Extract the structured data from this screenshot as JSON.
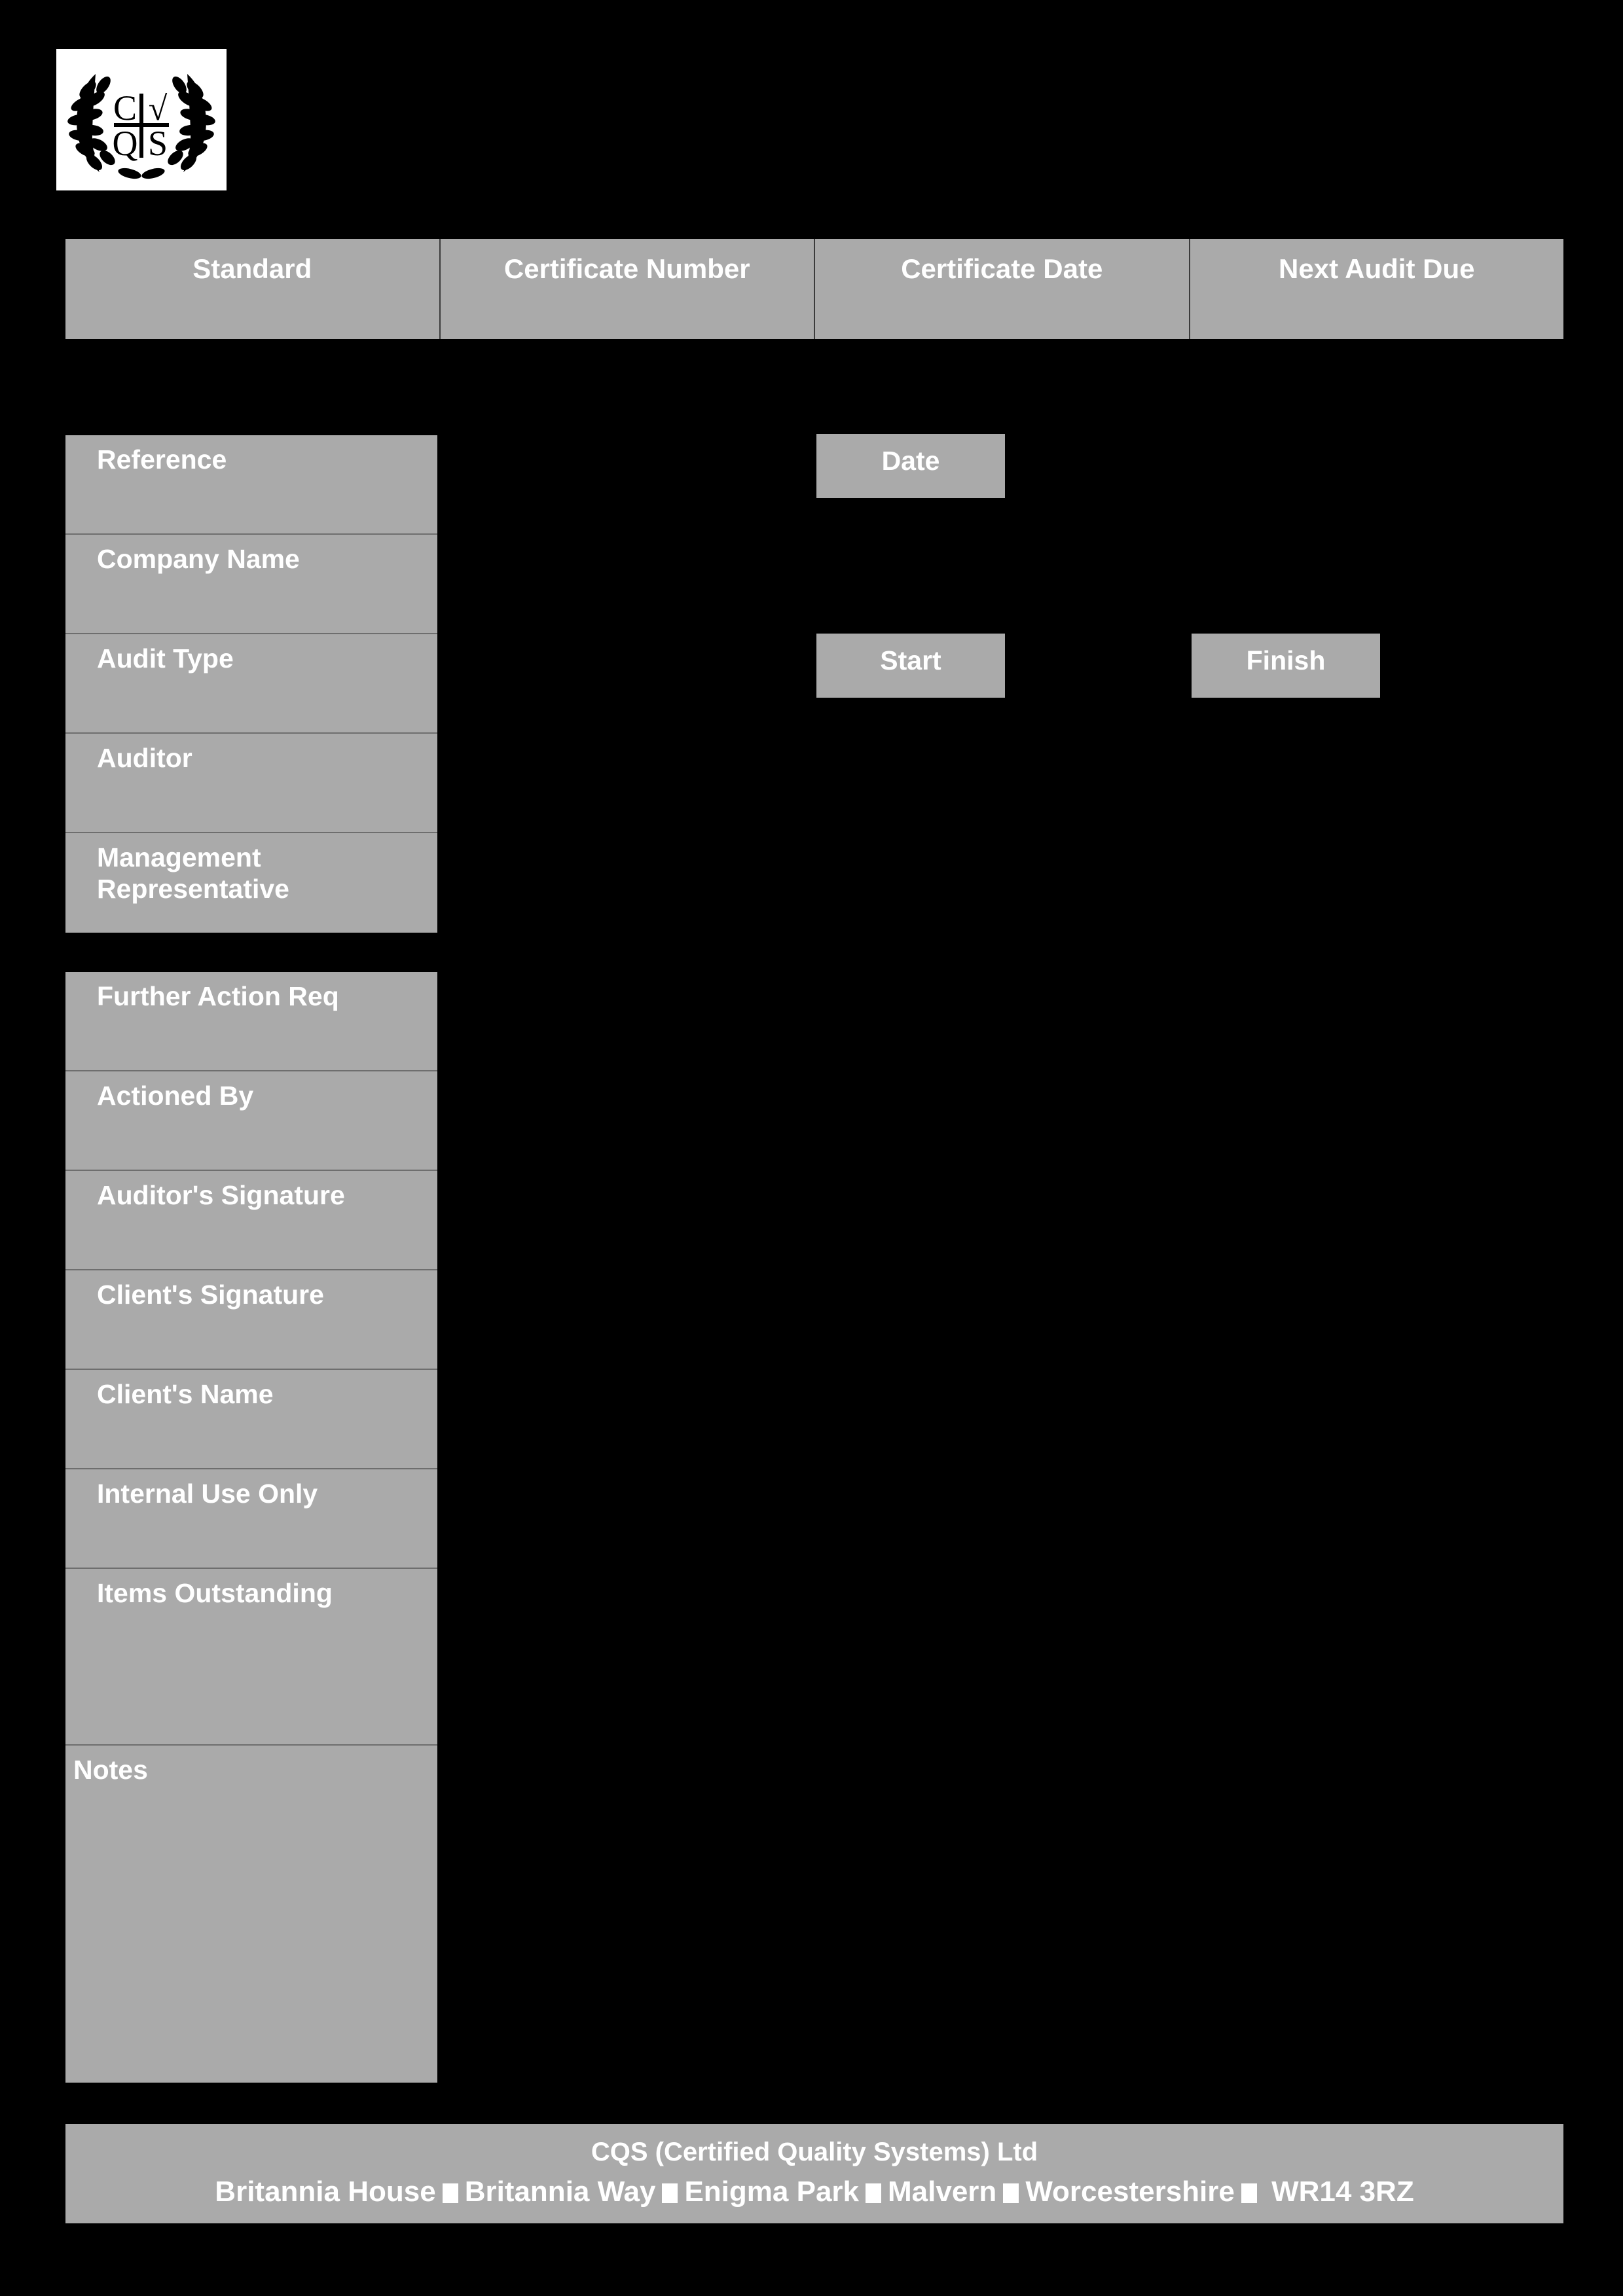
{
  "logo": {
    "name": "cqs-laurel-wreath-logo",
    "letters": [
      "C",
      "√",
      "Q",
      "S"
    ],
    "alt": "CQS laurel wreath logo"
  },
  "header": {
    "columns": [
      {
        "label": "Standard"
      },
      {
        "label": "Certificate Number"
      },
      {
        "label": "Certificate Date"
      },
      {
        "label": "Next Audit Due"
      }
    ]
  },
  "details_block": {
    "rows": [
      {
        "label": "Reference"
      },
      {
        "label": "Company Name"
      },
      {
        "label": "Audit Type"
      },
      {
        "label": "Auditor"
      },
      {
        "label": "Management Representative"
      }
    ]
  },
  "date_boxes": {
    "date": "Date",
    "start": "Start",
    "finish": "Finish"
  },
  "signoff_block": {
    "rows": [
      {
        "label": "Further Action Req"
      },
      {
        "label": "Actioned By"
      },
      {
        "label": "Auditor's Signature"
      },
      {
        "label": "Client's Signature"
      },
      {
        "label": "Client's Name"
      },
      {
        "label": "Internal Use Only"
      },
      {
        "label": "Items Outstanding"
      },
      {
        "label": "Notes"
      }
    ]
  },
  "footer": {
    "company": "CQS (Certified Quality Systems) Ltd",
    "address_parts": [
      "Britannia House",
      "Britannia Way",
      "Enigma Park",
      "Malvern",
      "Worcestershire",
      "WR14 3RZ"
    ],
    "separator": "■"
  },
  "colors": {
    "page_background": "#000000",
    "cell_fill": "#aaaaaa",
    "text": "#ffffff",
    "divider": "#6e6e6e",
    "header_divider": "#3b3b3b",
    "logo_background": "#ffffff"
  }
}
